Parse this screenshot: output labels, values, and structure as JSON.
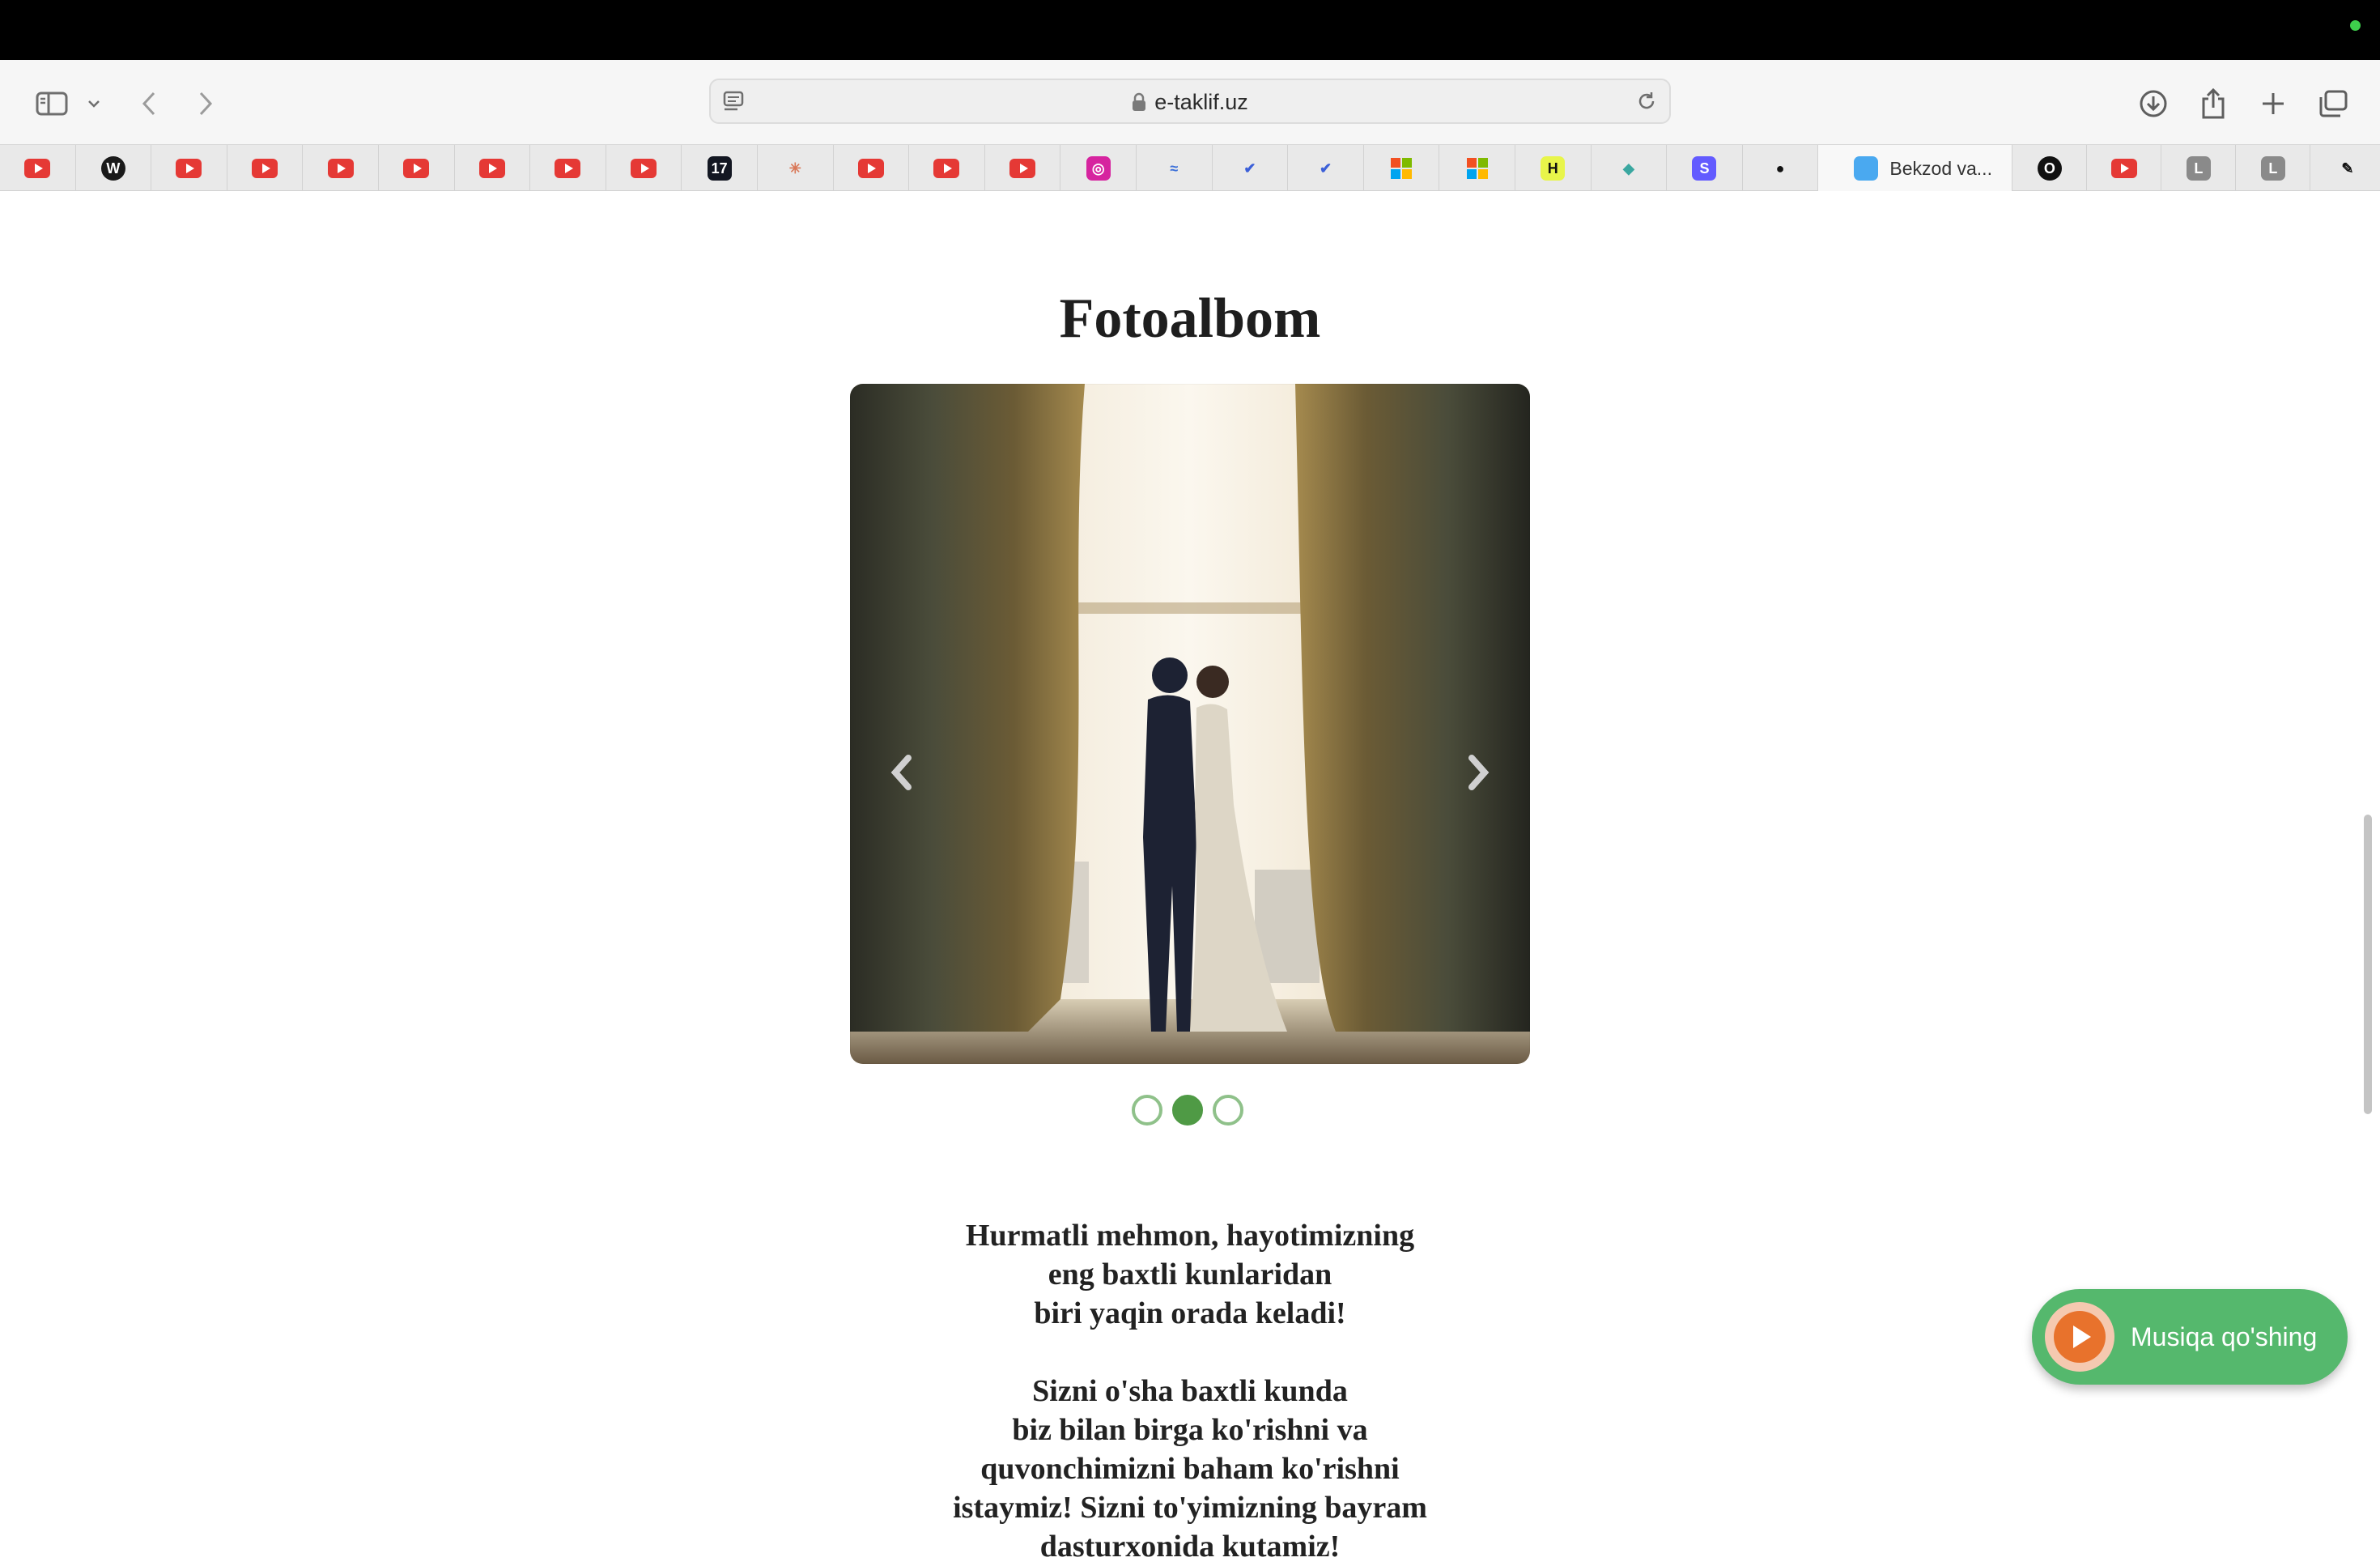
{
  "browser": {
    "url": "e-taklif.uz",
    "active_tab_label": "Bekzod va...",
    "status_dot_color": "#3ecf4c",
    "tabs": [
      {
        "icon": "youtube-icon"
      },
      {
        "icon": "wordpress-icon",
        "glyph": "W"
      },
      {
        "icon": "youtube-icon"
      },
      {
        "icon": "youtube-icon"
      },
      {
        "icon": "youtube-icon"
      },
      {
        "icon": "youtube-icon"
      },
      {
        "icon": "youtube-icon"
      },
      {
        "icon": "youtube-icon"
      },
      {
        "icon": "youtube-icon"
      },
      {
        "icon": "tradingview-icon",
        "glyph": "17"
      },
      {
        "icon": "claude-icon",
        "glyph": "✳"
      },
      {
        "icon": "youtube-icon"
      },
      {
        "icon": "youtube-icon"
      },
      {
        "icon": "youtube-icon"
      },
      {
        "icon": "instagram-icon",
        "glyph": "◎"
      },
      {
        "icon": "wave-icon",
        "glyph": "≈"
      },
      {
        "icon": "bird-icon",
        "glyph": "✔"
      },
      {
        "icon": "bird-icon",
        "glyph": "✔"
      },
      {
        "icon": "microsoft-icon"
      },
      {
        "icon": "microsoft-icon"
      },
      {
        "icon": "hotwire-icon",
        "glyph": "H"
      },
      {
        "icon": "diamond-icon",
        "glyph": "◆"
      },
      {
        "icon": "stripe-icon",
        "glyph": "S"
      },
      {
        "icon": "github-icon",
        "glyph": "●"
      },
      {
        "icon": "site-icon",
        "active": true
      },
      {
        "icon": "circle-icon",
        "glyph": "O"
      },
      {
        "icon": "youtube-icon"
      },
      {
        "icon": "letter-l-icon",
        "glyph": "L"
      },
      {
        "icon": "letter-l-icon",
        "glyph": "L"
      },
      {
        "icon": "key-icon",
        "glyph": "✎"
      }
    ]
  },
  "page": {
    "title": "Fotoalbom",
    "slider": {
      "current_slide": 2,
      "total_slides": 3
    },
    "invitation_lines": [
      "Hurmatli mehmon, hayotimizning",
      "eng baxtli kunlaridan",
      "biri yaqin orada keladi!",
      "",
      "Sizni o'sha baxtli kunda",
      "biz bilan birga ko'rishni va",
      "quvonchimizni baham ko'rishni",
      "istaymiz! Sizni to'yimizning bayram",
      "dasturxonida kutamiz!"
    ],
    "music_button_label": "Musiqa qo'shing",
    "accent_color": "#55b86d"
  }
}
